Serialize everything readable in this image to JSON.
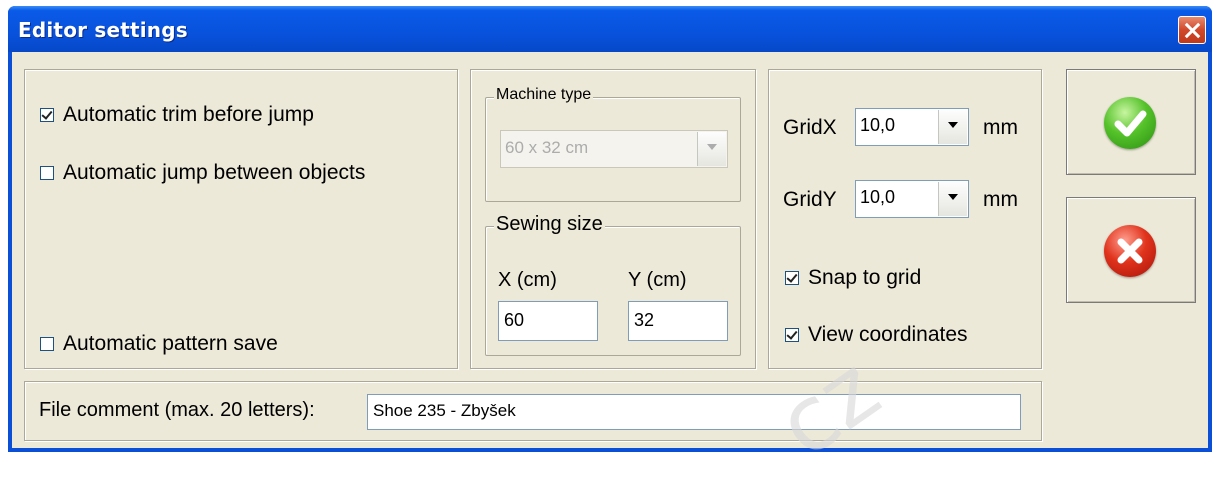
{
  "window": {
    "title": "Editor settings"
  },
  "options": {
    "auto_trim_label": "Automatic trim before jump",
    "auto_trim_checked": true,
    "auto_jump_label": "Automatic jump between objects",
    "auto_jump_checked": false,
    "auto_save_label": "Automatic pattern save",
    "auto_save_checked": false
  },
  "machine": {
    "legend": "Machine type",
    "value": "60 x 32 cm"
  },
  "sewing": {
    "legend": "Sewing size",
    "x_label": "X (cm)",
    "y_label": "Y (cm)",
    "x_value": "60",
    "y_value": "32"
  },
  "grid": {
    "gridx_label": "GridX",
    "gridx_value": "10,0",
    "gridx_unit": "mm",
    "gridy_label": "GridY",
    "gridy_value": "10,0",
    "gridy_unit": "mm",
    "snap_label": "Snap to grid",
    "snap_checked": true,
    "coords_label": "View coordinates",
    "coords_checked": true
  },
  "comment": {
    "label": "File comment (max. 20 letters):",
    "value": "Shoe 235 - Zbyšek"
  },
  "buttons": {
    "ok_icon": "checkmark-icon",
    "cancel_icon": "x-icon"
  },
  "watermark": "cz",
  "colors": {
    "titlebar": "#0852dc",
    "dialog_bg": "#ece9d8",
    "ok_green": "#55c22a",
    "cancel_red": "#e0331c"
  }
}
